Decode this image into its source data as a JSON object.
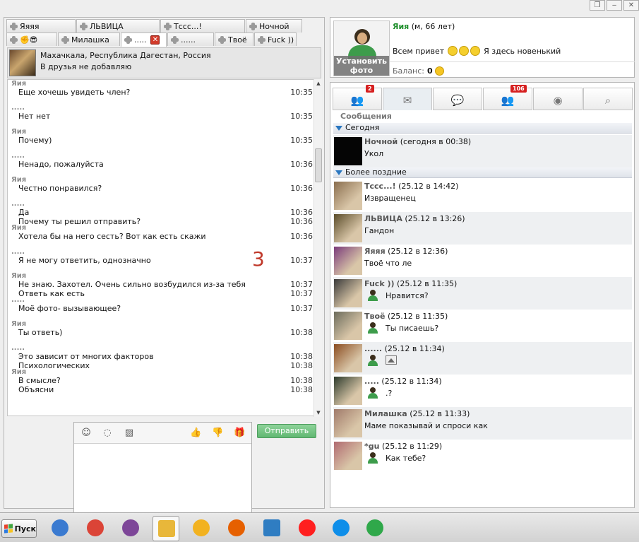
{
  "tabs_row1": [
    {
      "label": "Яяяя"
    },
    {
      "label": "ЛЬВИЦА"
    },
    {
      "label": "Тссс...!"
    },
    {
      "label": "Ночной"
    }
  ],
  "tabs_row2": [
    {
      "label": "😎"
    },
    {
      "label": "Милашка"
    },
    {
      "label": "....."
    },
    {
      "label": "......"
    },
    {
      "label": "Твоё"
    },
    {
      "label": "Fuck ))"
    }
  ],
  "close_glyph": "✕",
  "chat_info": {
    "location": "Махачкала, Республика Дагестан, Россия",
    "friend_status": "В друзья не добавляю"
  },
  "messages": [
    {
      "sender": "Яия",
      "lines": [
        {
          "text": "Еще хочешь увидеть член?",
          "time": "10:35"
        }
      ]
    },
    {
      "sender": ".....",
      "lines": [
        {
          "text": "Нет нет",
          "time": "10:35"
        }
      ]
    },
    {
      "sender": "Яия",
      "lines": [
        {
          "text": "Почему)",
          "time": "10:35"
        }
      ]
    },
    {
      "sender": ".....",
      "lines": [
        {
          "text": "Ненадо, пожалуйста",
          "time": "10:36"
        }
      ]
    },
    {
      "sender": "Яия",
      "lines": [
        {
          "text": "Честно понравился?",
          "time": "10:36"
        }
      ]
    },
    {
      "sender": ".....",
      "lines": [
        {
          "text": "Да",
          "time": "10:36"
        },
        {
          "text": "Почему ты решил отправить?",
          "time": "10:36"
        }
      ]
    },
    {
      "sender": "Яия",
      "lines": [
        {
          "text": "Хотела бы на него сесть? Вот как есть скажи",
          "time": "10:36"
        }
      ]
    },
    {
      "sender": ".....",
      "lines": [
        {
          "text": "Я не могу ответить, однозначно",
          "time": "10:37"
        }
      ]
    },
    {
      "sender": "Яия",
      "lines": [
        {
          "text": "Не знаю. Захотел. Очень сильно возбудился из-за тебя",
          "time": "10:37"
        },
        {
          "text": "Ответь как есть",
          "time": "10:37"
        }
      ]
    },
    {
      "sender": ".....",
      "lines": [
        {
          "text": "Моё фото- вызывающее?",
          "time": "10:37"
        }
      ]
    },
    {
      "sender": "Яия",
      "lines": [
        {
          "text": "Ты ответь)",
          "time": "10:38"
        }
      ]
    },
    {
      "sender": ".....",
      "lines": [
        {
          "text": "Это зависит от многих факторов",
          "time": "10:38"
        },
        {
          "text": "Психологических",
          "time": "10:38"
        }
      ]
    },
    {
      "sender": "Яия",
      "lines": [
        {
          "text": "В смысле?",
          "time": "10:38"
        },
        {
          "text": "Объясни",
          "time": "10:38"
        }
      ]
    }
  ],
  "overlay_number": "3",
  "composer": {
    "send_label": "Отправить"
  },
  "profile": {
    "name": "Яия",
    "meta": "(м, 66 лет)",
    "status_before": "Всем привет",
    "status_after": "Я здесь новенький",
    "balance_label": "Баланс:",
    "balance_value": "0",
    "set_photo_label": "Установить фото"
  },
  "nav_tabs": [
    {
      "icon": "👥",
      "badge": "2"
    },
    {
      "icon": "✉",
      "badge": ""
    },
    {
      "icon": "💬",
      "badge": ""
    },
    {
      "icon": "👥",
      "badge": "106"
    },
    {
      "icon": "◉",
      "badge": ""
    },
    {
      "icon": "⌕",
      "badge": ""
    }
  ],
  "dialogs_title": "Сообщения",
  "groups": {
    "today": "Сегодня",
    "older": "Более поздние"
  },
  "dialogs_today": [
    {
      "name": "Ночной",
      "when": "(сегодня в 00:38)",
      "text": "Укол",
      "mine": false,
      "photo_only": false,
      "thumb": "#050505"
    }
  ],
  "dialogs_older": [
    {
      "name": "Тссс...!",
      "when": "(25.12 в 14:42)",
      "text": "Извращенец",
      "mine": false,
      "photo_only": false,
      "thumb": "#8a6e4e"
    },
    {
      "name": "ЛЬВИЦА",
      "when": "(25.12 в 13:26)",
      "text": "Гандон",
      "mine": false,
      "photo_only": false,
      "thumb": "#5a4c2a"
    },
    {
      "name": "Яяяя",
      "when": "(25.12 в 12:36)",
      "text": "Твоё что ле",
      "mine": false,
      "photo_only": false,
      "thumb": "#7a3a7a"
    },
    {
      "name": "Fuck ))",
      "when": "(25.12 в 11:35)",
      "text": "Нравится?",
      "mine": true,
      "photo_only": false,
      "thumb": "#3a3a3a"
    },
    {
      "name": "Твоё",
      "when": "(25.12 в 11:35)",
      "text": "Ты писаешь?",
      "mine": true,
      "photo_only": false,
      "thumb": "#6c6c5c"
    },
    {
      "name": "......",
      "when": "(25.12 в 11:34)",
      "text": "",
      "mine": true,
      "photo_only": true,
      "thumb": "#8a4c20"
    },
    {
      "name": ".....",
      "when": "(25.12 в 11:34)",
      "text": ".?",
      "mine": true,
      "photo_only": false,
      "thumb": "#2c3a2c"
    },
    {
      "name": "Милашка",
      "when": "(25.12 в 11:33)",
      "text": "Маме показывай и спроси как",
      "mine": false,
      "photo_only": false,
      "thumb": "#a07a6a"
    },
    {
      "name": "*gu",
      "when": "(25.12 в 11:29)",
      "text": "Как тебе?",
      "mine": true,
      "photo_only": false,
      "thumb": "#b06a70"
    }
  ],
  "taskbar": {
    "start_label": "Пуск",
    "apps": [
      {
        "name": "network-app-icon",
        "color": "#3a7ad0"
      },
      {
        "name": "chrome-icon",
        "color": "#db4437"
      },
      {
        "name": "tor-browser-icon",
        "color": "#7d4698"
      },
      {
        "name": "file-explorer-icon",
        "color": "#e8b73a"
      },
      {
        "name": "paw-app-icon",
        "color": "#f2b220"
      },
      {
        "name": "firefox-icon",
        "color": "#e66000"
      },
      {
        "name": "remote-desktop-icon",
        "color": "#2f7dc2"
      },
      {
        "name": "yandex-browser-icon",
        "color": "#ff1f1f"
      },
      {
        "name": "teamviewer-icon",
        "color": "#0e8ee9"
      },
      {
        "name": "messenger-clover-icon",
        "color": "#2fa84a"
      }
    ]
  }
}
